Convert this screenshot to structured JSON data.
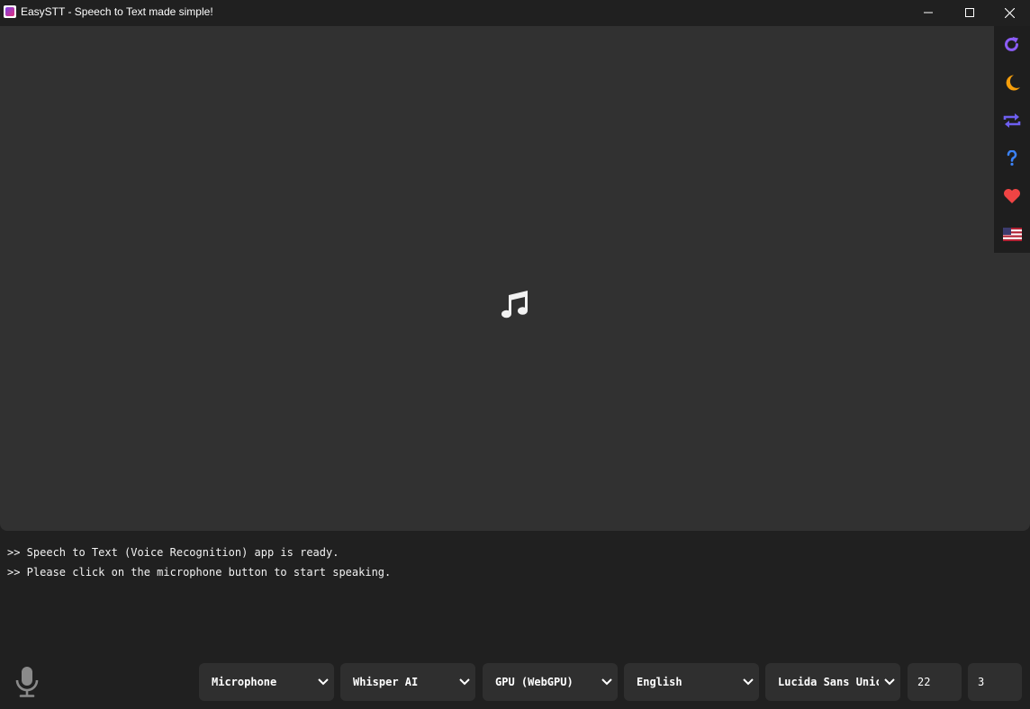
{
  "window": {
    "title": "EasySTT - Speech to Text made simple!",
    "controls": [
      "minimize-icon",
      "maximize-icon",
      "close-icon"
    ]
  },
  "viewer": {
    "center_icon": "music-note-icon"
  },
  "sidebar": {
    "items": [
      {
        "icon": "refresh-icon",
        "color": "#8b5cf6"
      },
      {
        "icon": "moon-icon",
        "color": "#f59e0b"
      },
      {
        "icon": "repeat-icon",
        "color": "#6d5ff0"
      },
      {
        "icon": "help-icon",
        "color": "#3b82f6"
      },
      {
        "icon": "heart-icon",
        "color": "#ef4444"
      },
      {
        "icon": "us-flag-icon",
        "color": "#b22234"
      }
    ]
  },
  "log": {
    "lines": [
      ">> Speech to Text (Voice Recognition) app is ready.",
      ">> Please click on the microphone button to start speaking."
    ]
  },
  "controls": {
    "mic_icon": "microphone-icon",
    "source": "Microphone",
    "engine": "Whisper AI",
    "device": "GPU (WebGPU)",
    "language": "English",
    "font": "Lucida Sans Unicode",
    "font_size": "22",
    "lines": "3"
  }
}
